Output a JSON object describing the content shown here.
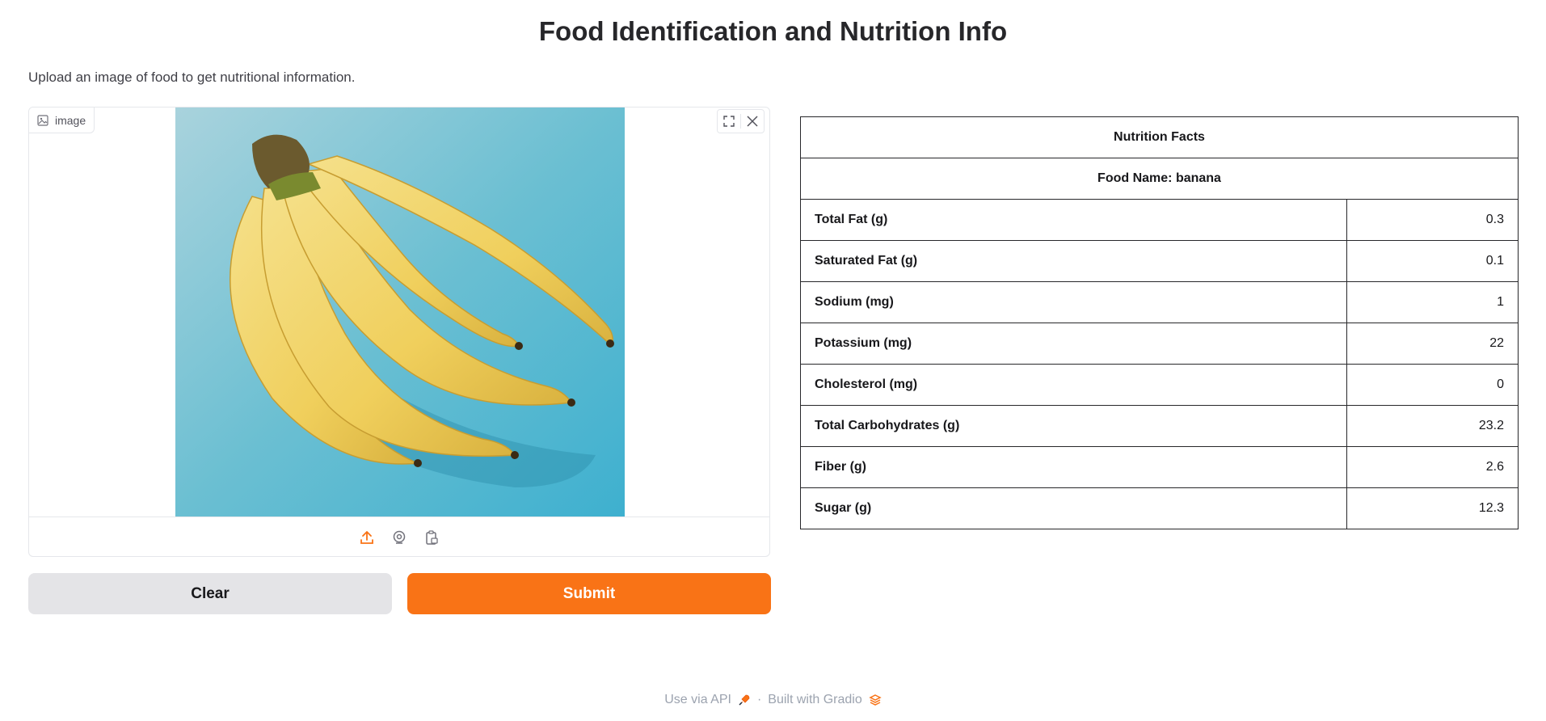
{
  "page": {
    "title": "Food Identification and Nutrition Info",
    "description": "Upload an image of food to get nutritional information."
  },
  "image_input": {
    "label": "image",
    "controls": [
      "fullscreen-icon",
      "close-icon"
    ],
    "sources": [
      "upload-icon",
      "webcam-icon",
      "clipboard-icon"
    ],
    "accent_color": "#f97316"
  },
  "buttons": {
    "clear_label": "Clear",
    "submit_label": "Submit"
  },
  "nutrition": {
    "header": "Nutrition Facts",
    "food_name": "Food Name: banana",
    "rows": [
      {
        "label": "Total Fat (g)",
        "value": "0.3"
      },
      {
        "label": "Saturated Fat (g)",
        "value": "0.1"
      },
      {
        "label": "Sodium (mg)",
        "value": "1"
      },
      {
        "label": "Potassium (mg)",
        "value": "22"
      },
      {
        "label": "Cholesterol (mg)",
        "value": "0"
      },
      {
        "label": "Total Carbohydrates (g)",
        "value": "23.2"
      },
      {
        "label": "Fiber (g)",
        "value": "2.6"
      },
      {
        "label": "Sugar (g)",
        "value": "12.3"
      }
    ]
  },
  "footer": {
    "api_label": "Use via API",
    "separator": "·",
    "built_label": "Built with Gradio"
  }
}
